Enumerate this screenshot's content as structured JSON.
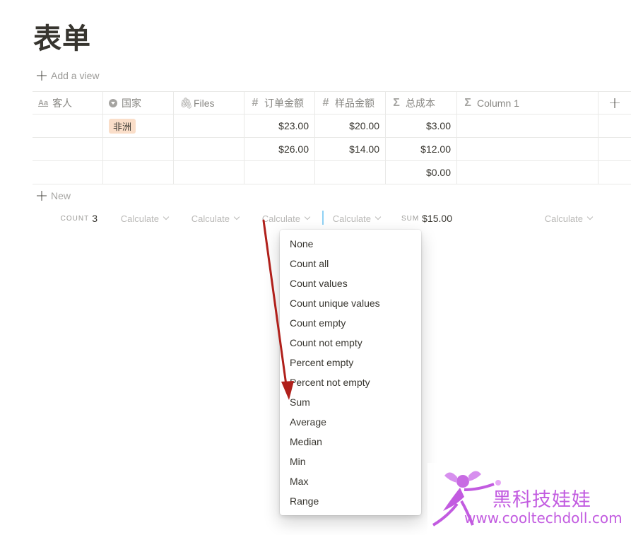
{
  "page": {
    "title": "表单"
  },
  "toolbar": {
    "add_view": "Add a view"
  },
  "table": {
    "columns": [
      {
        "label": "客人",
        "icon": "text-property-icon"
      },
      {
        "label": "国家",
        "icon": "select-property-icon"
      },
      {
        "label": "Files",
        "icon": "paperclip-icon"
      },
      {
        "label": "订单金额",
        "icon": "number-property-icon"
      },
      {
        "label": "样品金额",
        "icon": "number-property-icon"
      },
      {
        "label": "总成本",
        "icon": "formula-sigma-icon"
      },
      {
        "label": "Column 1",
        "icon": "formula-sigma-icon"
      }
    ],
    "add_column": "+",
    "rows": [
      {
        "guest": "",
        "country": "非洲",
        "files": "",
        "order": "$23.00",
        "sample": "$20.00",
        "total": "$3.00",
        "col1": ""
      },
      {
        "guest": "",
        "country": "",
        "files": "",
        "order": "$26.00",
        "sample": "$14.00",
        "total": "$12.00",
        "col1": ""
      },
      {
        "guest": "",
        "country": "",
        "files": "",
        "order": "",
        "sample": "",
        "total": "$0.00",
        "col1": ""
      }
    ],
    "new_row": "New",
    "tag_color": "#fadec9"
  },
  "calc": {
    "count_label": "COUNT",
    "count_value": "3",
    "calculate": "Calculate",
    "sum_label": "SUM",
    "sum_value": "$15.00"
  },
  "menu": {
    "items": [
      "None",
      "Count all",
      "Count values",
      "Count unique values",
      "Count empty",
      "Count not empty",
      "Percent empty",
      "Percent not empty",
      "Sum",
      "Average",
      "Median",
      "Min",
      "Max",
      "Range"
    ]
  },
  "annotation": {
    "arrow_color": "#b0201b"
  },
  "watermark": {
    "name": "黑科技娃娃",
    "url": "www.cooltechdoll.com",
    "color": "#c25be0"
  }
}
